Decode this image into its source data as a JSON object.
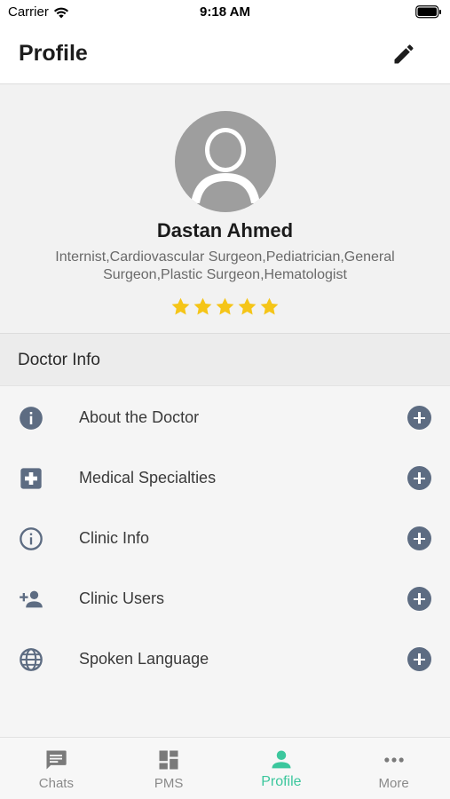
{
  "status_bar": {
    "carrier": "Carrier",
    "time": "9:18 AM"
  },
  "app_bar": {
    "title": "Profile"
  },
  "profile": {
    "name": "Dastan Ahmed",
    "specialties": "Internist,Cardiovascular Surgeon,Pediatrician,General Surgeon,Plastic Surgeon,Hematologist",
    "rating": 5,
    "rating_max": 5
  },
  "doctor_info": {
    "title": "Doctor Info",
    "items": [
      {
        "label": "About the Doctor",
        "icon": "info-filled-icon"
      },
      {
        "label": "Medical Specialties",
        "icon": "medical-plus-icon"
      },
      {
        "label": "Clinic Info",
        "icon": "info-outline-icon"
      },
      {
        "label": "Clinic Users",
        "icon": "person-add-icon"
      },
      {
        "label": "Spoken Language",
        "icon": "globe-icon"
      }
    ]
  },
  "tabs": [
    {
      "label": "Chats",
      "icon": "chat-icon",
      "active": false
    },
    {
      "label": "PMS",
      "icon": "dashboard-icon",
      "active": false
    },
    {
      "label": "Profile",
      "icon": "person-icon",
      "active": true
    },
    {
      "label": "More",
      "icon": "more-icon",
      "active": false
    }
  ],
  "colors": {
    "accent": "#3cc79d",
    "star": "#f5c518",
    "icon": "#5d6c82"
  }
}
